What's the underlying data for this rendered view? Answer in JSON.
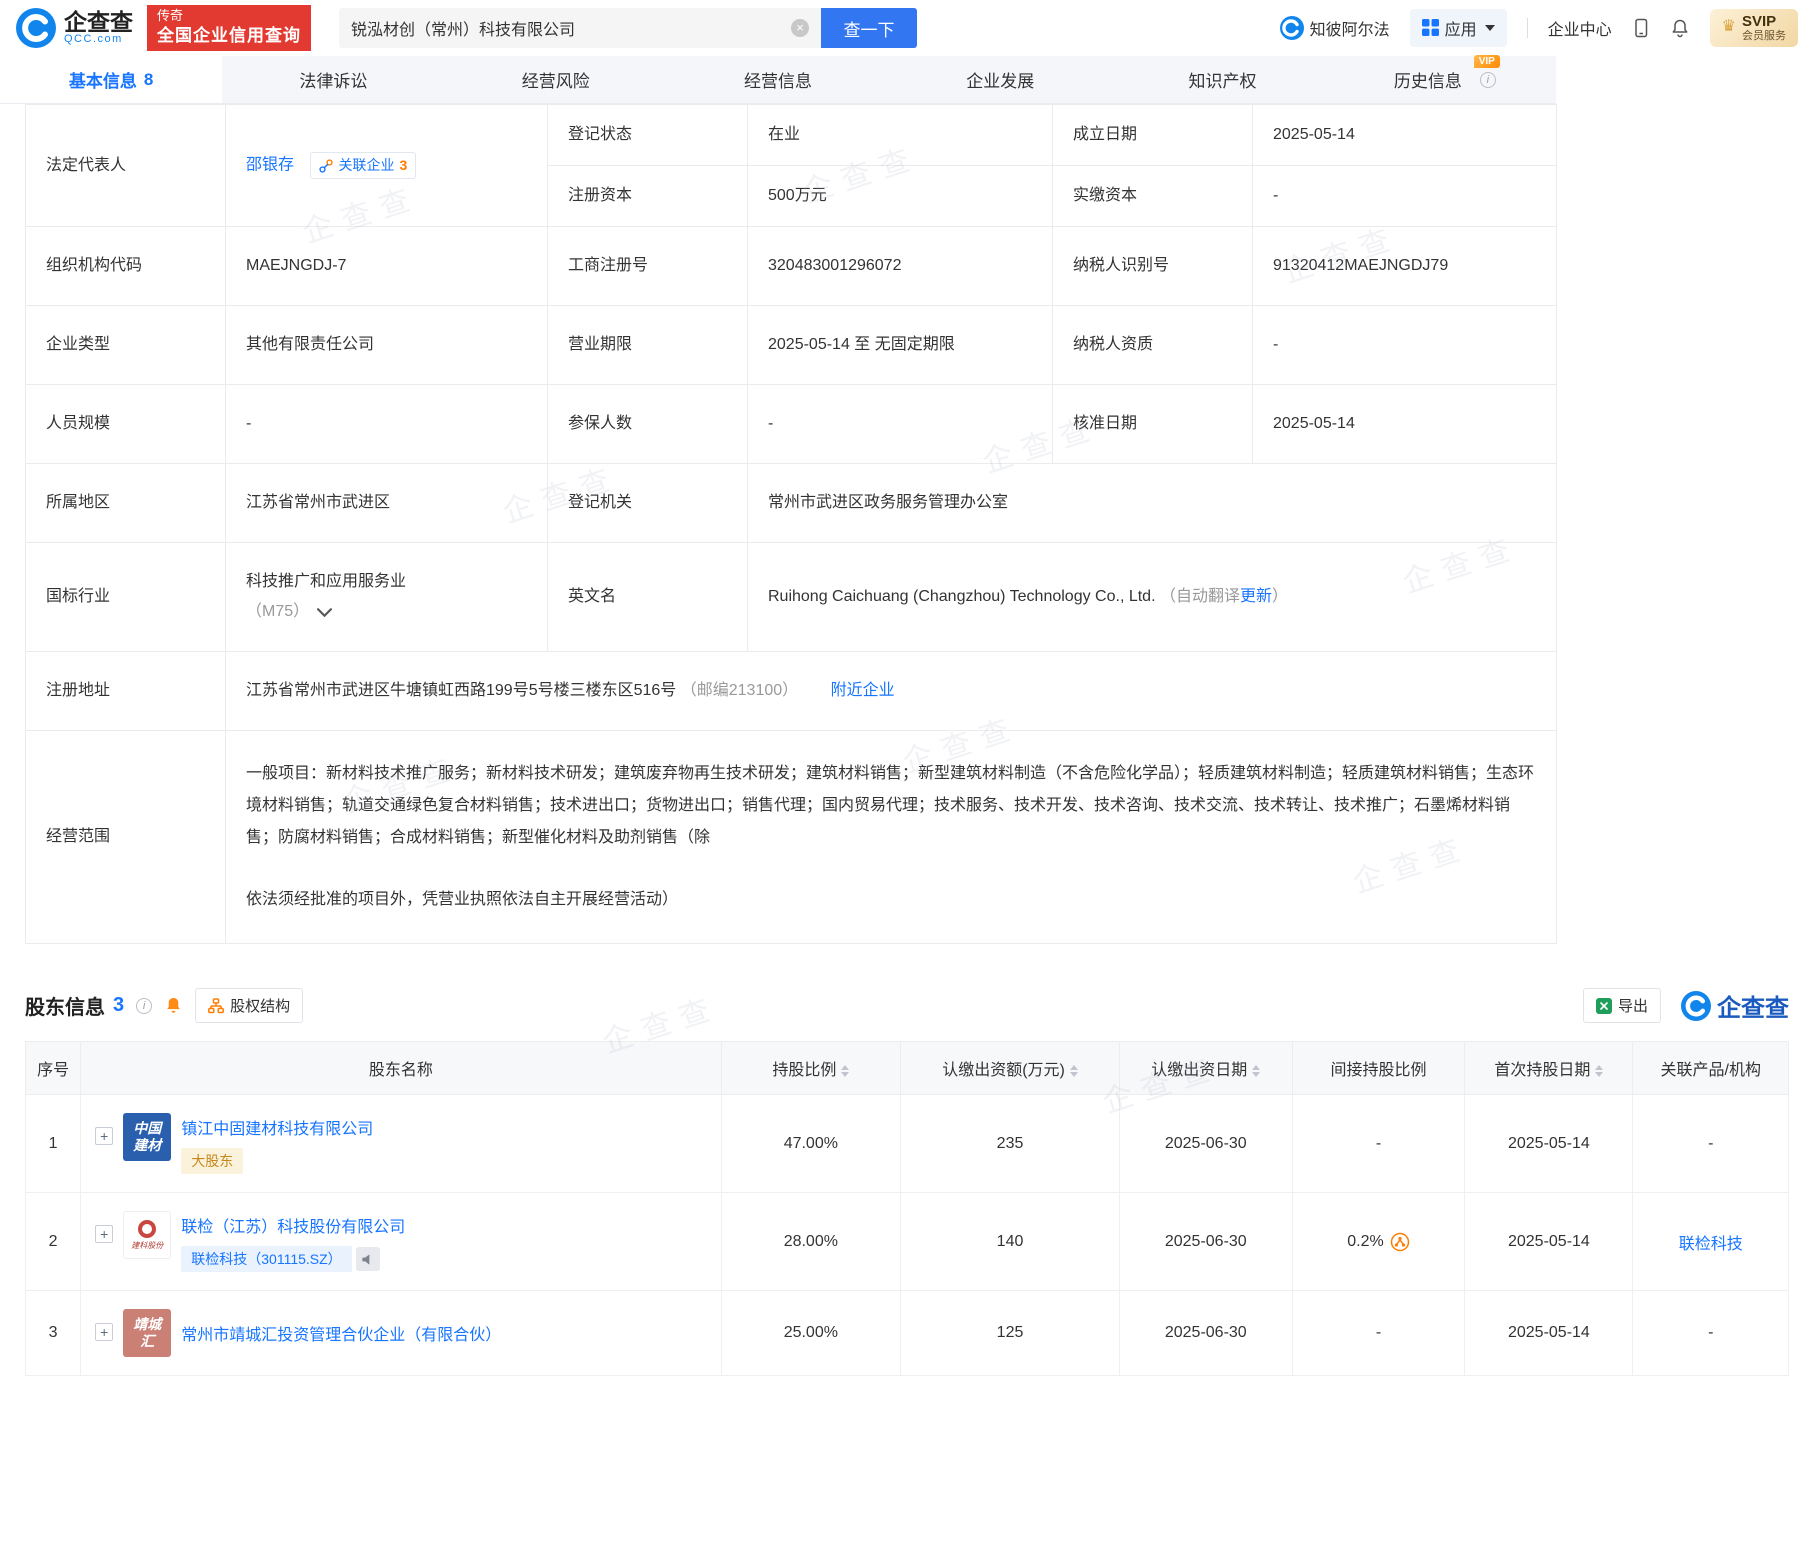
{
  "icons": {
    "clear": "×",
    "plus": "+",
    "crown": "♛",
    "info": "i"
  },
  "watermark": {
    "text": "企查查"
  },
  "header": {
    "logo_name": "企查查",
    "logo_domain": "QCC.com",
    "promo_line1": "传奇",
    "promo_line2": "全国企业信用查询",
    "search_value": "锐泓材创（常州）科技有限公司",
    "search_button": "查一下",
    "zhibi_alpha": "知彼阿尔法",
    "apps": "应用",
    "enterprise_center": "企业中心",
    "svip_title": "SVIP",
    "svip_sub": "会员服务"
  },
  "tabs": [
    {
      "label": "基本信息",
      "count": "8"
    },
    {
      "label": "法律诉讼"
    },
    {
      "label": "经营风险"
    },
    {
      "label": "经营信息"
    },
    {
      "label": "企业发展"
    },
    {
      "label": "知识产权"
    },
    {
      "label": "历史信息",
      "badge": "VIP"
    }
  ],
  "basic_info": {
    "legal_rep_label": "法定代表人",
    "legal_rep_name": "邵银存",
    "related_label": "关联企业",
    "related_count": "3",
    "reg_status_label": "登记状态",
    "reg_status": "在业",
    "establish_label": "成立日期",
    "establish_date": "2025-05-14",
    "reg_capital_label": "注册资本",
    "reg_capital": "500万元",
    "paid_capital_label": "实缴资本",
    "paid_capital": "-",
    "org_code_label": "组织机构代码",
    "org_code": "MAEJNGDJ-7",
    "biz_reg_label": "工商注册号",
    "biz_reg_no": "320483001296072",
    "taxpayer_label": "纳税人识别号",
    "taxpayer_id": "91320412MAEJNGDJ79",
    "type_label": "企业类型",
    "type": "其他有限责任公司",
    "term_label": "营业期限",
    "term": "2025-05-14 至 无固定期限",
    "tax_qual_label": "纳税人资质",
    "tax_qual": "-",
    "staff_label": "人员规模",
    "staff": "-",
    "insured_label": "参保人数",
    "insured": "-",
    "approval_label": "核准日期",
    "approval_date": "2025-05-14",
    "region_label": "所属地区",
    "region": "江苏省常州市武进区",
    "authority_label": "登记机关",
    "authority": "常州市武进区政务服务管理办公室",
    "industry_label": "国标行业",
    "industry": "科技推广和应用服务业",
    "industry_code": "（M75）",
    "en_name_label": "英文名",
    "en_name": "Ruihong Caichuang (Changzhou) Technology Co., Ltd.",
    "en_note_prefix": "（自动翻译",
    "en_note_link": "更新",
    "en_note_suffix": "）",
    "address_label": "注册地址",
    "address": "江苏省常州市武进区牛塘镇虹西路199号5号楼三楼东区516号",
    "address_zip": "（邮编213100）",
    "nearby_link": "附近企业",
    "scope_label": "经营范围",
    "scope_p1": "一般项目：新材料技术推广服务；新材料技术研发；建筑废弃物再生技术研发；建筑材料销售；新型建筑材料制造（不含危险化学品）；轻质建筑材料制造；轻质建筑材料销售；生态环境材料销售；轨道交通绿色复合材料销售；技术进出口；货物进出口；销售代理；国内贸易代理；技术服务、技术开发、技术咨询、技术交流、技术转让、技术推广；石墨烯材料销售；防腐材料销售；合成材料销售；新型催化材料及助剂销售（除",
    "scope_p2": "依法须经批准的项目外，凭营业执照依法自主开展经营活动）"
  },
  "shareholders": {
    "title": "股东信息",
    "count": "3",
    "equity_btn": "股权结构",
    "export_btn": "导出",
    "qcc_brand": "企查查",
    "columns": [
      "序号",
      "股东名称",
      "持股比例",
      "认缴出资额(万元)",
      "认缴出资日期",
      "间接持股比例",
      "首次持股日期",
      "关联产品/机构"
    ],
    "rows": [
      {
        "seq": "1",
        "logo_line1": "中国",
        "logo_line2": "建材",
        "name": "镇江中固建材科技有限公司",
        "tag": "大股东",
        "ratio": "47.00%",
        "amount": "235",
        "sub_date": "2025-06-30",
        "indirect": "-",
        "first_date": "2025-05-14",
        "related": "-"
      },
      {
        "seq": "2",
        "logo_text": "建科股份",
        "name": "联检（江苏）科技股份有限公司",
        "tag": "联检科技（301115.SZ）",
        "ratio": "28.00%",
        "amount": "140",
        "sub_date": "2025-06-30",
        "indirect": "0.2%",
        "first_date": "2025-05-14",
        "related": "联检科技"
      },
      {
        "seq": "3",
        "logo_line1": "靖城",
        "logo_line2": "汇",
        "name": "常州市靖城汇投资管理合伙企业（有限合伙）",
        "ratio": "25.00%",
        "amount": "125",
        "sub_date": "2025-06-30",
        "indirect": "-",
        "first_date": "2025-05-14",
        "related": "-"
      }
    ]
  }
}
